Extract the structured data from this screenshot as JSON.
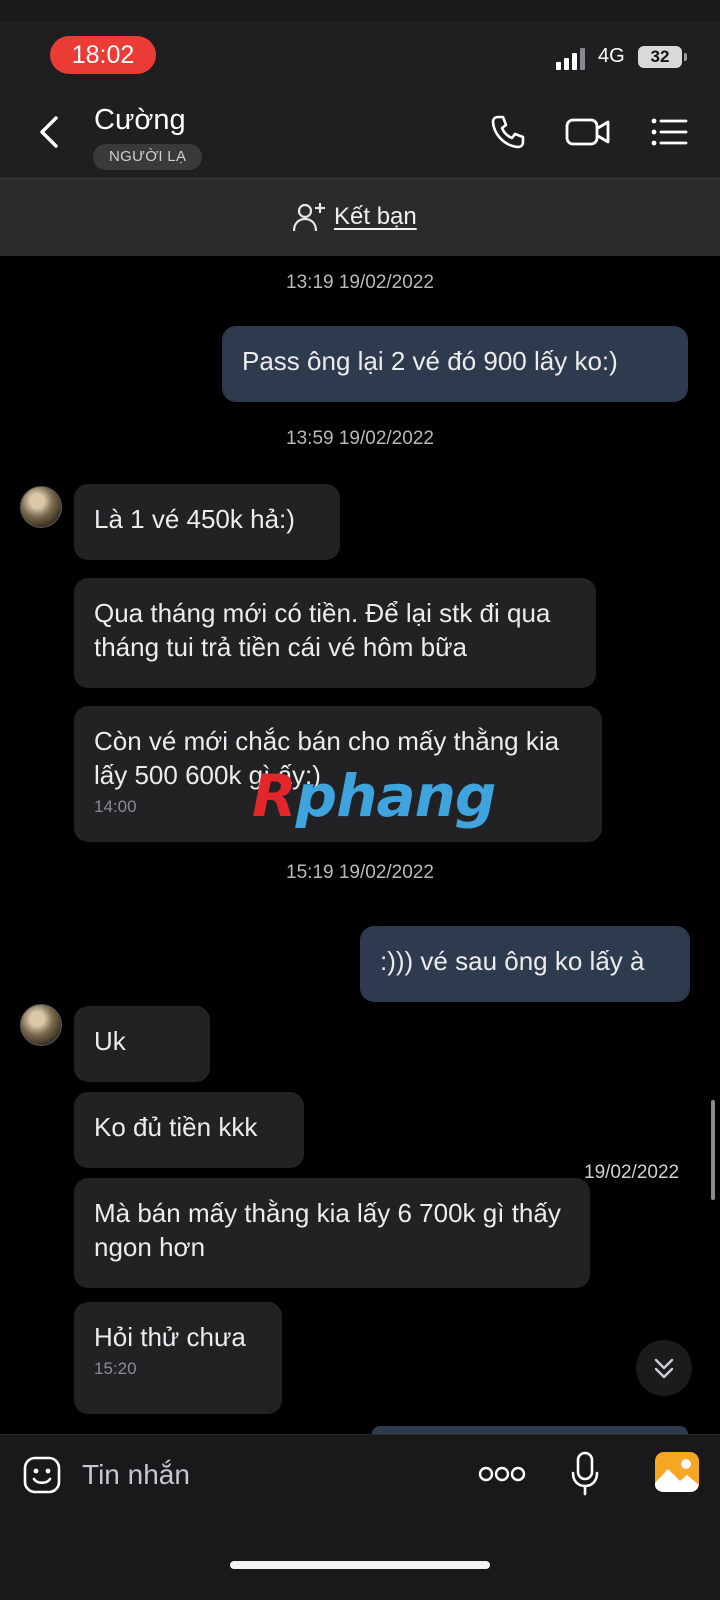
{
  "status_bar": {
    "time": "18:02",
    "network": "4G",
    "battery": "32"
  },
  "header": {
    "contact_name": "Cường",
    "badge": "NGƯỜI LẠ"
  },
  "add_friend": {
    "label": "Kết bạn"
  },
  "chat": {
    "ts1": "13:19 19/02/2022",
    "msg1": "Pass ông lại 2 vé đó 900 lấy ko:)",
    "ts2": "13:59 19/02/2022",
    "msg2": "Là 1 vé 450k hả:)",
    "msg3": "Qua tháng mới có tiền. Để lại stk đi qua tháng tui trả tiền cái vé hôm bữa",
    "msg4": "Còn vé mới chắc bán cho mấy thằng kia lấy 500 600k gì ấy:)",
    "msg4_time": "14:00",
    "ts3": "15:19 19/02/2022",
    "msg5": ":))) vé sau ông ko lấy à",
    "msg6": "Uk",
    "msg7": "Ko đủ tiền kkk",
    "side_date": "19/02/2022",
    "msg8": "Mà bán mấy thằng kia lấy 6 700k gì thấy ngon hơn",
    "msg9": "Hỏi thử chưa",
    "msg9_time": "15:20"
  },
  "watermark": {
    "first": "R",
    "rest": "phang"
  },
  "composer": {
    "placeholder": "Tin nhắn"
  },
  "colors": {
    "clock_pill": "#ea3b34",
    "sent_bubble": "#2e3a4d",
    "recv_bubble": "#222225",
    "accent_image": "#f5a623"
  },
  "icons": [
    "back-arrow-icon",
    "phone-icon",
    "video-camera-icon",
    "list-menu-icon",
    "add-person-icon",
    "emoji-icon",
    "more-dots-icon",
    "microphone-icon",
    "image-icon",
    "chevron-double-down-icon"
  ]
}
